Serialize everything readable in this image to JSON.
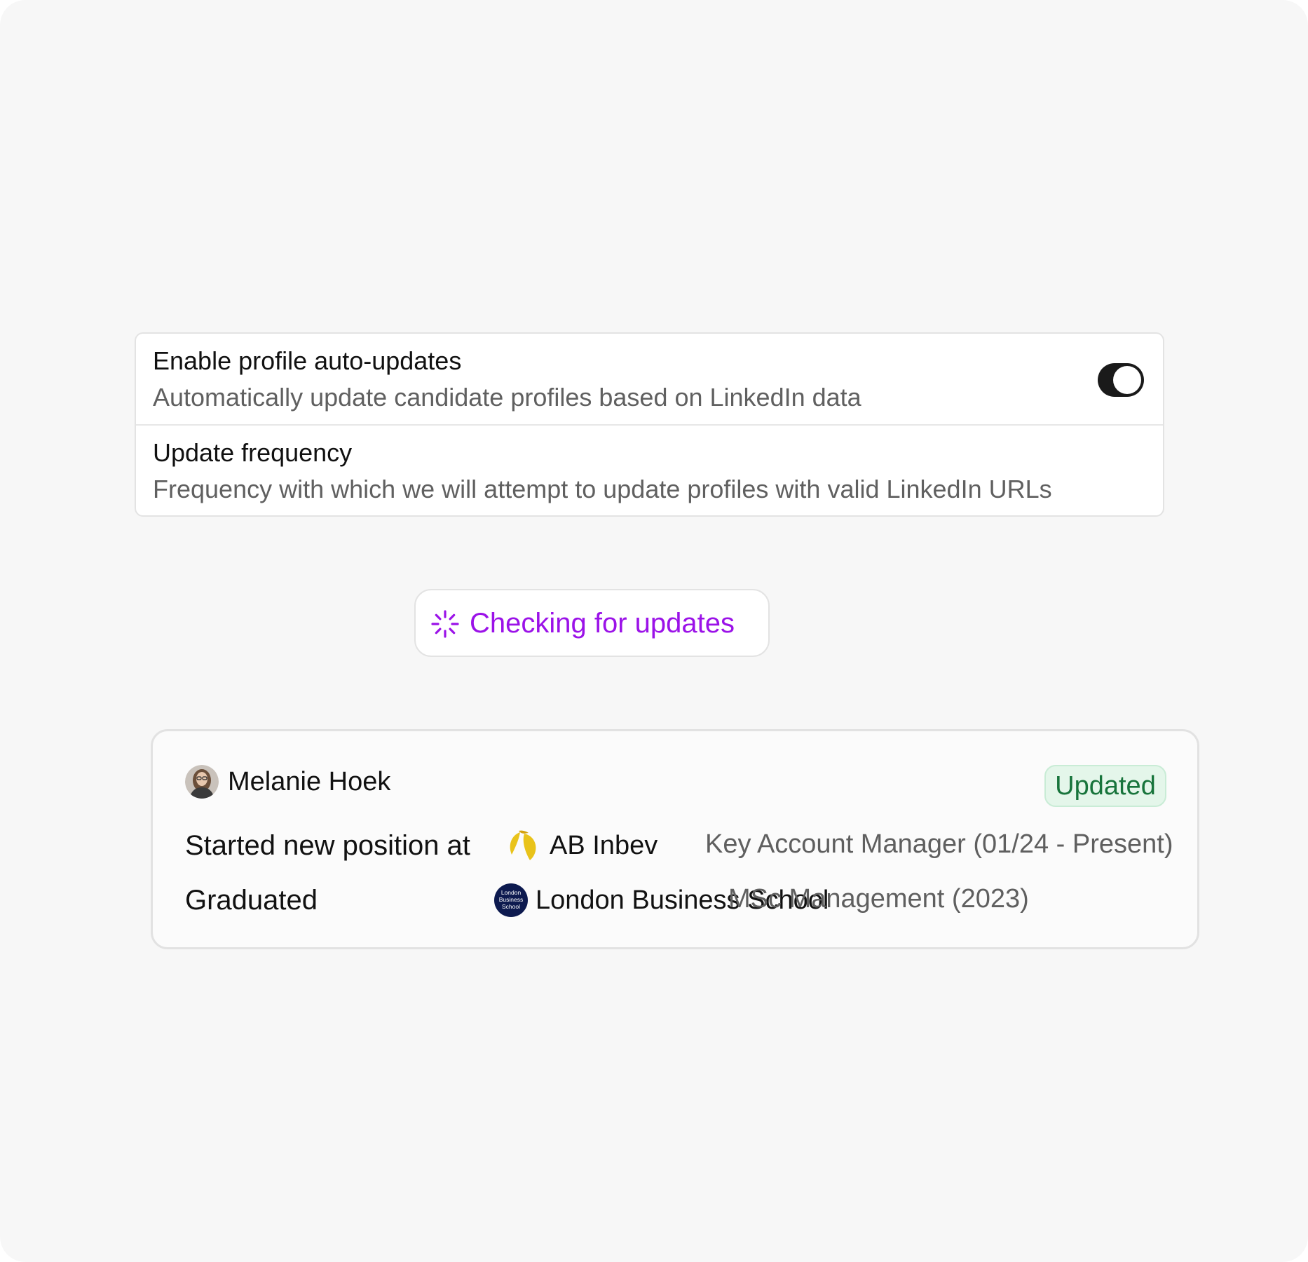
{
  "settings": {
    "auto_updates": {
      "title": "Enable profile auto-updates",
      "description": "Automatically update candidate profiles based on LinkedIn data",
      "enabled": true
    },
    "frequency": {
      "title": "Update frequency",
      "description": "Frequency with which we will attempt to update profiles with valid LinkedIn URLs"
    }
  },
  "status_pill": {
    "label": "Checking for updates",
    "icon": "spinner-icon",
    "color": "#9b12e8"
  },
  "candidate": {
    "name": "Melanie Hoek",
    "badge": "Updated",
    "badge_color": "#17743b",
    "events": [
      {
        "label": "Started new position at",
        "org": "AB Inbev",
        "org_icon": "ab-inbev-logo-icon",
        "detail": "Key Account Manager (01/24 - Present)"
      },
      {
        "label": "Graduated",
        "org": "London Business School",
        "org_icon": "london-business-school-logo-icon",
        "logo_text": [
          "London",
          "Business",
          "School"
        ],
        "detail": "MSc Management (2023)"
      }
    ]
  }
}
